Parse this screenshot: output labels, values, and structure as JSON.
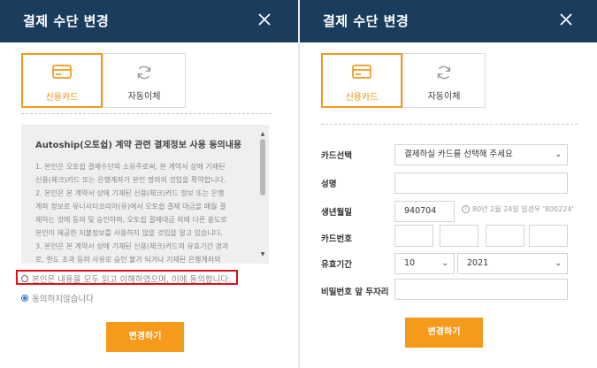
{
  "colors": {
    "header_bg": "#1b3d5d",
    "accent": "#f59a1b",
    "highlight": "#e0101c"
  },
  "left": {
    "title": "결제 수단 변경",
    "tabs": [
      {
        "label": "신용카드",
        "icon": "credit-card-icon",
        "active": true
      },
      {
        "label": "자동이체",
        "icon": "refresh-icon",
        "active": false
      }
    ],
    "agreement": {
      "title": "Autoship(오토쉽) 계약 관련 결제정보 사용 동의내용",
      "lines": [
        "1. 본인은 오토쉽 결제수단의 소유주로써, 본 계약서 상에 기재된",
        "신용(체크)카드 또는 은행계좌가 본인 명의의 것임을 확약합니다.",
        "2. 본인은 본 계약서 상에 기재된 신용(체크)카드 정보 또는 은행",
        "계좌 정보로 유니시티코리아(유)에서 오토쉽 결제 대금을 매월 결",
        "제하는 것에 동의 및 승인하며, 오토쉽 결제대금 외에 다른 용도로",
        "본인이 제공한 지불정보를 사용하지 않을 것임을 알고 있습니다.",
        "3. 본인은 본 계약서 상에 기재된 신용(체크)카드의 유효기간 경과",
        "로, 한도 초과 등의 사유로 승인 불가 되거나 기재된 은행계좌의"
      ]
    },
    "radio_agree": "본인은 내용을 모두 읽고 이해하였으며, 이에 동의합니다.",
    "radio_disagree": "동의하지않습니다",
    "submit": "변경하기"
  },
  "right": {
    "title": "결제 수단 변경",
    "tabs": [
      {
        "label": "신용카드",
        "icon": "credit-card-icon",
        "active": true
      },
      {
        "label": "자동이체",
        "icon": "refresh-icon",
        "active": false
      }
    ],
    "form": {
      "card_select_label": "카드선택",
      "card_select_value": "결제하실 카드를 선택해 주세요",
      "name_label": "성명",
      "name_value": "",
      "birth_label": "생년월일",
      "birth_value": "940704",
      "birth_hint": "80년 2월 24일 일경우 '800224'",
      "card_number_label": "카드번호",
      "card_number_parts": [
        "",
        "",
        "",
        ""
      ],
      "expiry_label": "유효기간",
      "expiry_month": "10",
      "expiry_year": "2021",
      "password_label": "비밀번호 앞 두자리",
      "password_value": ""
    },
    "submit": "변경하기"
  }
}
